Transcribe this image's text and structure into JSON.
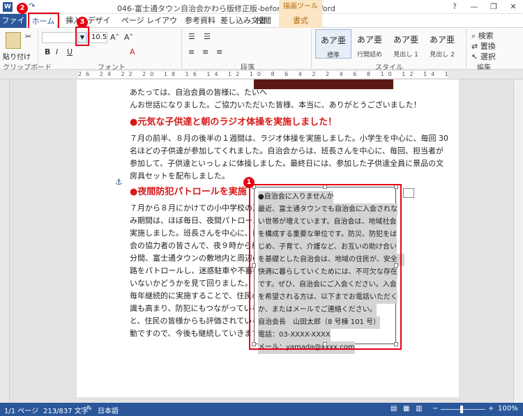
{
  "titlebar": {
    "app_icon": "W",
    "undo": "↶",
    "redo": "↷",
    "title": "046-富士通タウン自治会かわら版修正版-beforer.docx - Word",
    "context_tool": "描画ツール",
    "help": "?",
    "minimize": "—",
    "restore": "❐",
    "close": "✕"
  },
  "tabs": [
    {
      "label": "ファイル"
    },
    {
      "label": "ホーム"
    },
    {
      "label": "挿入"
    },
    {
      "label": "デザイン"
    },
    {
      "label": "ページ レイアウト"
    },
    {
      "label": "参考資料"
    },
    {
      "label": "差し込み文書"
    },
    {
      "label": "校閲"
    },
    {
      "label": "表示"
    },
    {
      "label": "書式"
    }
  ],
  "ribbon": {
    "paste": "貼り付け",
    "clipboard": "クリップボード",
    "font_size": "10.5",
    "font": "フォント",
    "paragraph": "段落",
    "styles_label": "スタイル",
    "editing": "編集",
    "find": "検索",
    "replace": "置換",
    "select": "選択",
    "styles": [
      {
        "sample": "あア亜",
        "name": "標準"
      },
      {
        "sample": "あア亜",
        "name": "行間詰め"
      },
      {
        "sample": "あア亜",
        "name": "見出し 1"
      },
      {
        "sample": "あア亜",
        "name": "見出し 2"
      }
    ]
  },
  "ruler": "26 24 22 20 18 16 14 12 10 8 6 4 2 2 4 6 8 10 12 14 16 18 20 22 24 26 28",
  "document": {
    "intro_line1": "あたっては、自治会員の皆様に、たいへ",
    "intro_line2": "んお世話になりました。ご協力いただいた皆様、本当に、ありがとうございました！",
    "heading1": "●元気な子供達と朝のラジオ体操を実施しました！",
    "para1": [
      "７月の前半、８月の後半の１週間は、ラジオ体操を実施しました。小学生を中心に、毎回 30",
      "名ほどの子供達が参加してくれました。自治会からは、班長さんを中心に、毎回、担当者が",
      "参加して、子供達といっしょに体操しました。最終日には、参加した子供達全員に景品の文",
      "房具セットを配布しました。"
    ],
    "heading2": "●夜間防犯パトロールを実施",
    "para2": [
      "７月から８月にかけての小中学校の夏休",
      "み期間は、ほぼ毎日、夜間パトロールを",
      "実施しました。班長さんを中心に、自治",
      "会の協力者の皆さんで、夜９時から約 30",
      "分間、富士通タウンの敷地内と周辺の道",
      "路をパトロールし、迷惑駐車や不審者が",
      "いないかどうかを見て回りました。",
      "毎年継続的に実施することで、住民の意",
      "識も高まり、防犯にもつながっている",
      "と、住民の皆様からも評価されている活",
      "動ですので、今後も継続していきます。"
    ],
    "textbox": [
      "●自治会に入りませんか",
      "最近、富士通タウンでも自治会に入会されな",
      "い世帯が増えています。自治会は、地域社会",
      "を構成する重要な単位です。防災、防犯をは",
      "じめ、子育て、介護など、お互いの助け合い",
      "を基礎とした自治会は、地域の住民が、安全・",
      "快適に暮らしていくためには、不可欠な存在",
      "です。ぜひ、自治会にご入会ください。入会",
      "を希望される方は、以下までお電話いただく",
      "か、またはメールでご連絡ください。",
      "自治会長　山田太郎（8 号棟 101 号）",
      "電話：03-XXXX-XXXX",
      "メール：yamada@xxxx.com"
    ]
  },
  "badges": {
    "one": "1",
    "two": "2",
    "three": "3"
  },
  "statusbar": {
    "page": "1/1 ページ",
    "words": "213/837 文字",
    "lang": "日本語",
    "zoom": "100%"
  },
  "colors": {
    "word_blue": "#2b579a",
    "heading_red": "#d81818",
    "callout_red": "#e60012"
  }
}
